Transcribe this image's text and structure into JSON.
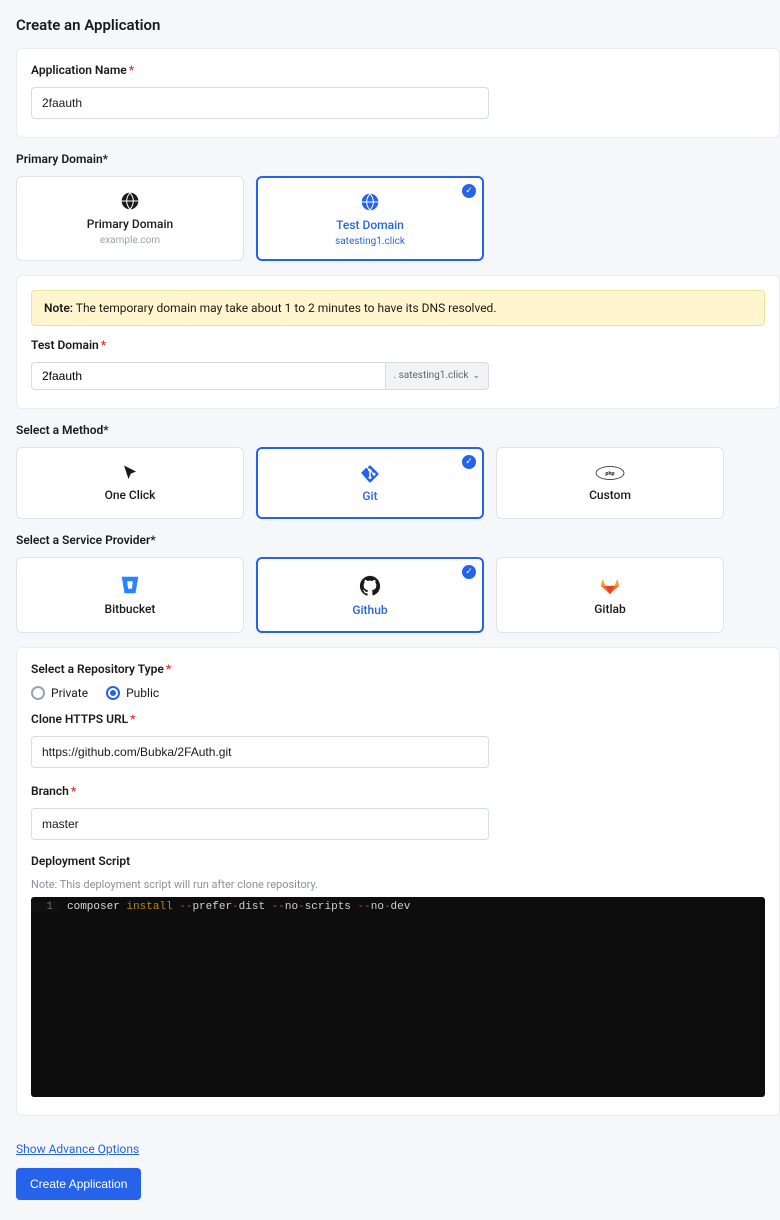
{
  "title": "Create an Application",
  "appName": {
    "label": "Application Name",
    "value": "2faauth"
  },
  "primaryDomain": {
    "label": "Primary Domain",
    "options": [
      {
        "title": "Primary Domain",
        "sub": "example.com"
      },
      {
        "title": "Test Domain",
        "sub": "satesting1.click"
      }
    ]
  },
  "note": {
    "prefix": "Note:",
    "text": " The temporary domain may take about 1 to 2 minutes to have its DNS resolved."
  },
  "testDomain": {
    "label": "Test Domain",
    "value": "2faauth",
    "suffix": ". satesting1.click"
  },
  "method": {
    "label": "Select a Method",
    "options": [
      "One Click",
      "Git",
      "Custom"
    ]
  },
  "provider": {
    "label": "Select a Service Provider",
    "options": [
      "Bitbucket",
      "Github",
      "Gitlab"
    ]
  },
  "repoType": {
    "label": "Select a Repository Type",
    "private": "Private",
    "public": "Public"
  },
  "cloneUrl": {
    "label": "Clone HTTPS URL",
    "value": "https://github.com/Bubka/2FAuth.git"
  },
  "branch": {
    "label": "Branch",
    "value": "master"
  },
  "deployScript": {
    "label": "Deployment Script",
    "note": "Note: This deployment script will run after clone repository.",
    "line1_cmd": "composer",
    "line1_arg1": "install",
    "line1_d1": "--",
    "line1_f1a": "prefer",
    "line1_f1b": "dist",
    "line1_d2": "--",
    "line1_f2a": "no",
    "line1_f2b": "scripts",
    "line1_d3": "--",
    "line1_f3a": "no",
    "line1_f3b": "dev"
  },
  "advance": "Show Advance Options",
  "createBtn": "Create Application"
}
